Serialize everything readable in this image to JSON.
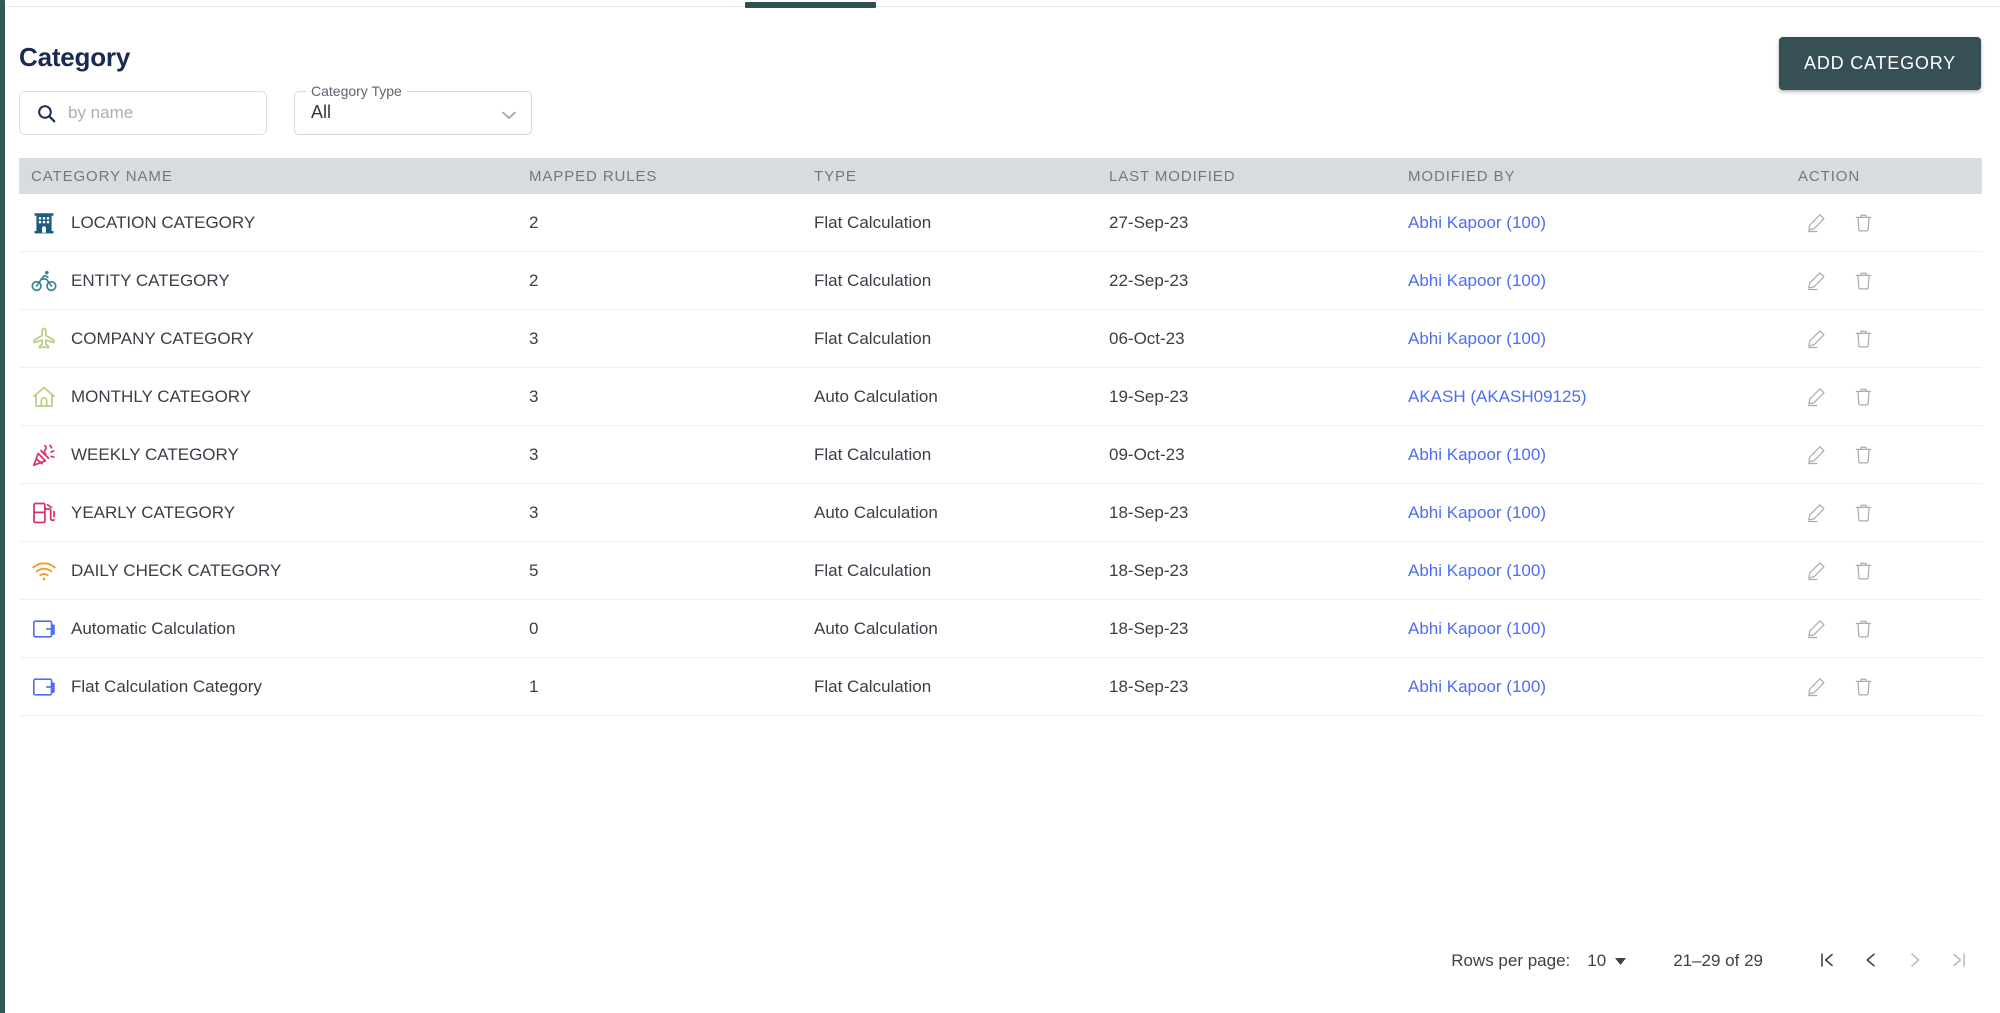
{
  "window": {
    "accent_dark": "#375055",
    "tab_indicator_color": "#2f4f52"
  },
  "header": {
    "title": "Category",
    "add_button_label": "ADD CATEGORY"
  },
  "search": {
    "placeholder": "by name",
    "value": "",
    "icon": "search-icon"
  },
  "category_type_select": {
    "label": "Category Type",
    "value": "All",
    "icon": "chevron-down-icon"
  },
  "table": {
    "columns": [
      "CATEGORY NAME",
      "MAPPED RULES",
      "TYPE",
      "LAST MODIFIED",
      "MODIFIED BY",
      "ACTION"
    ],
    "rows": [
      {
        "icon": "building-icon",
        "icon_color": "#1c5b80",
        "name": "LOCATION CATEGORY",
        "mapped_rules": "2",
        "type": "Flat Calculation",
        "last_modified": "27-Sep-23",
        "modified_by": "Abhi Kapoor (100)"
      },
      {
        "icon": "bicycle-icon",
        "icon_color": "#35808f",
        "name": "ENTITY CATEGORY",
        "mapped_rules": "2",
        "type": "Flat Calculation",
        "last_modified": "22-Sep-23",
        "modified_by": "Abhi Kapoor (100)"
      },
      {
        "icon": "airplane-icon",
        "icon_color": "#b7cf84",
        "name": "COMPANY CATEGORY",
        "mapped_rules": "3",
        "type": "Flat Calculation",
        "last_modified": "06-Oct-23",
        "modified_by": "Abhi Kapoor (100)"
      },
      {
        "icon": "home-icon",
        "icon_color": "#b7cf84",
        "name": "MONTHLY CATEGORY",
        "mapped_rules": "3",
        "type": "Auto Calculation",
        "last_modified": "19-Sep-23",
        "modified_by": "AKASH (AKASH09125)"
      },
      {
        "icon": "party-popper-icon",
        "icon_color": "#d6336c",
        "name": "WEEKLY CATEGORY",
        "mapped_rules": "3",
        "type": "Flat Calculation",
        "last_modified": "09-Oct-23",
        "modified_by": "Abhi Kapoor (100)"
      },
      {
        "icon": "fuel-pump-icon",
        "icon_color": "#d6336c",
        "name": "YEARLY CATEGORY",
        "mapped_rules": "3",
        "type": "Auto Calculation",
        "last_modified": "18-Sep-23",
        "modified_by": "Abhi Kapoor (100)"
      },
      {
        "icon": "wifi-icon",
        "icon_color": "#f0a030",
        "name": "DAILY CHECK CATEGORY",
        "mapped_rules": "5",
        "type": "Flat Calculation",
        "last_modified": "18-Sep-23",
        "modified_by": "Abhi Kapoor (100)"
      },
      {
        "icon": "wallet-icon",
        "icon_color": "#4d6df3",
        "name": "Automatic Calculation",
        "mapped_rules": "0",
        "type": "Auto Calculation",
        "last_modified": "18-Sep-23",
        "modified_by": "Abhi Kapoor (100)"
      },
      {
        "icon": "wallet-icon",
        "icon_color": "#4d6df3",
        "name": "Flat Calculation Category",
        "mapped_rules": "1",
        "type": "Flat Calculation",
        "last_modified": "18-Sep-23",
        "modified_by": "Abhi Kapoor (100)"
      }
    ],
    "row_actions": {
      "edit_icon": "pencil-icon",
      "delete_icon": "trash-icon"
    }
  },
  "paginator": {
    "rows_per_page_label": "Rows per page:",
    "rows_per_page_value": "10",
    "range_label": "21–29 of 29",
    "first_page_icon": "first-page-icon",
    "prev_page_icon": "previous-page-icon",
    "next_page_icon": "next-page-icon",
    "last_page_icon": "last-page-icon"
  }
}
